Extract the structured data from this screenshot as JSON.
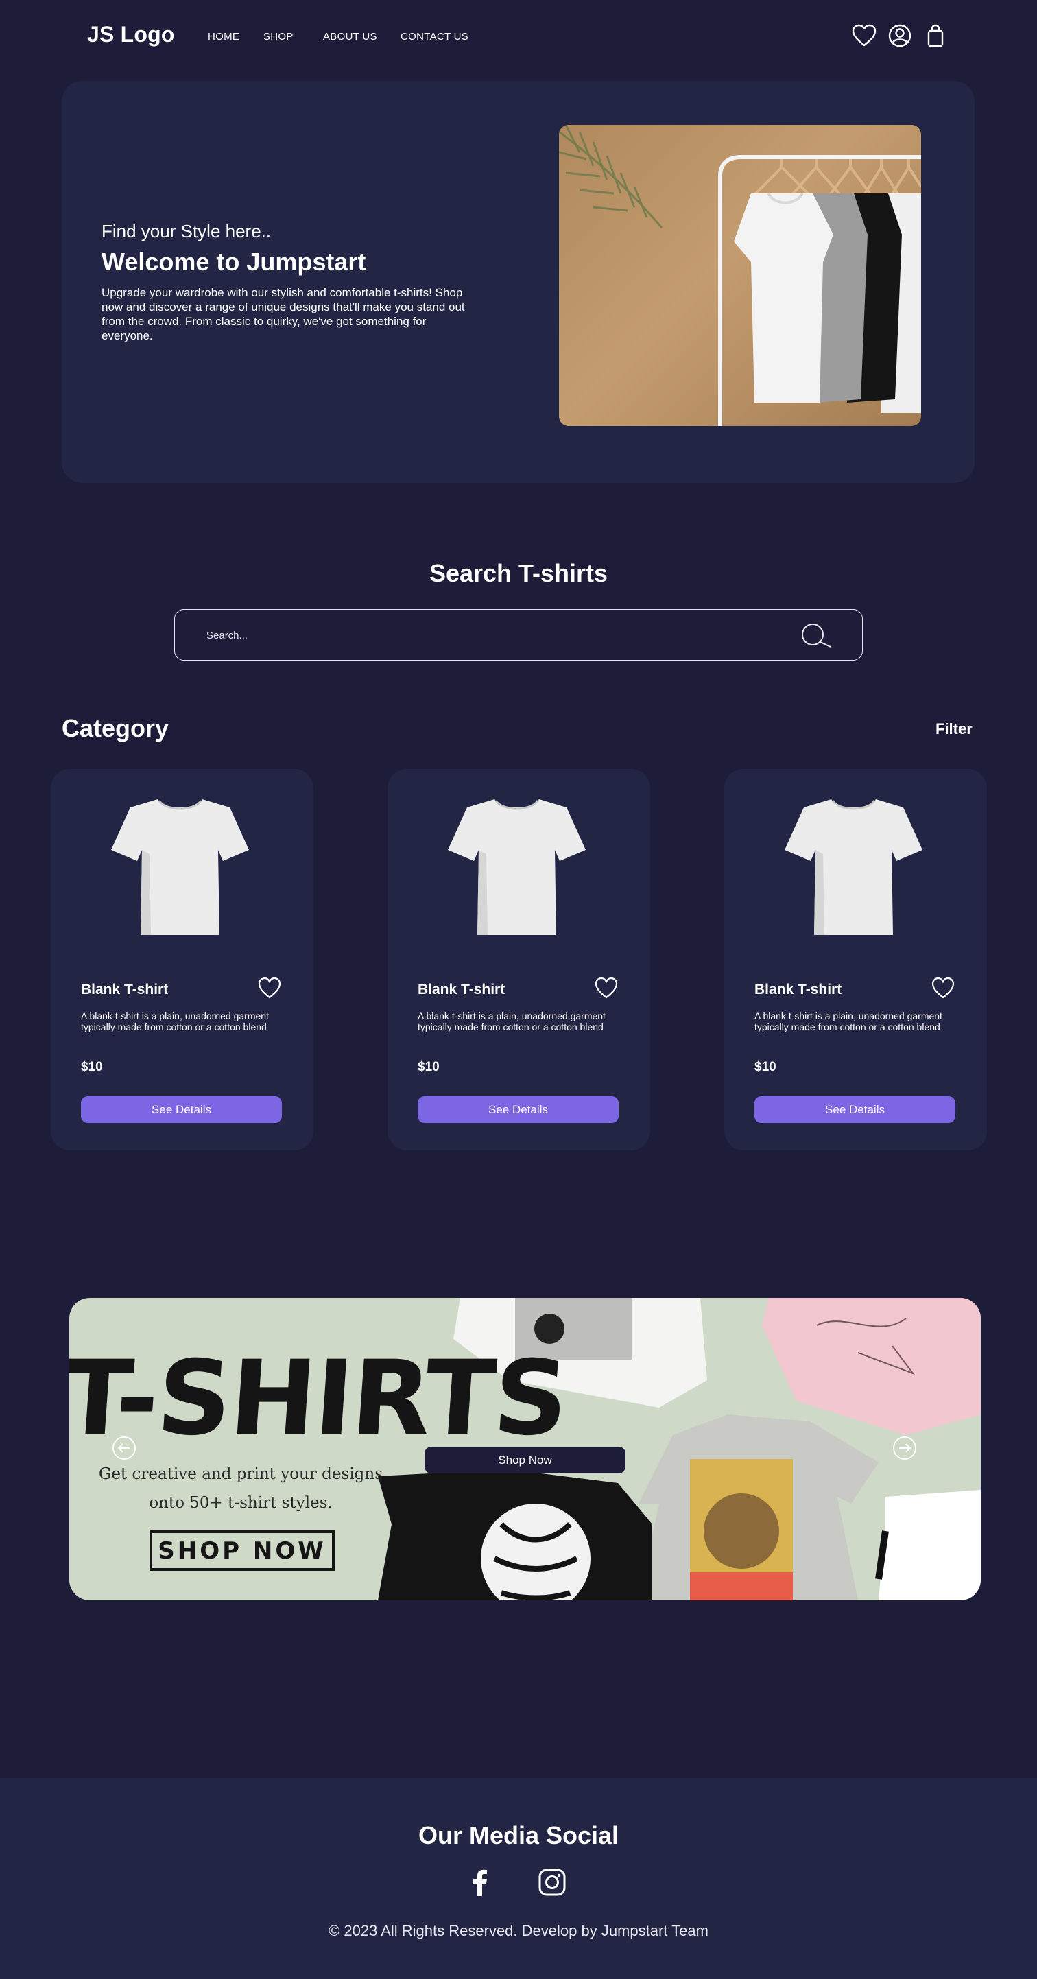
{
  "header": {
    "logo": "JS Logo",
    "nav": [
      "HOME",
      "SHOP",
      "ABOUT US",
      "CONTACT US"
    ],
    "icons": [
      "heart-icon",
      "user-icon",
      "bag-icon"
    ]
  },
  "hero": {
    "subtitle": "Find your Style here..",
    "title": "Welcome to Jumpstart",
    "description": "Upgrade your wardrobe with our stylish and comfortable t-shirts! Shop now and discover a range of unique designs that'll make you stand out from the crowd. From classic to quirky, we've got something for everyone."
  },
  "search": {
    "title": "Search T-shirts",
    "placeholder": "Search..."
  },
  "category": {
    "title": "Category",
    "filter_label": "Filter",
    "products": [
      {
        "name": "Blank T-shirt",
        "description": "A blank t-shirt is a plain, unadorned garment typically made from cotton or a cotton blend",
        "price": "$10",
        "button": "See Details"
      },
      {
        "name": "Blank T-shirt",
        "description": "A blank t-shirt is a plain, unadorned garment typically made from cotton or a cotton blend",
        "price": "$10",
        "button": "See Details"
      },
      {
        "name": "Blank T-shirt",
        "description": "A blank t-shirt is a plain, unadorned garment typically made from cotton or a cotton blend",
        "price": "$10",
        "button": "See Details"
      }
    ]
  },
  "banner": {
    "image_word": "T-SHIRTS",
    "image_copy": "Get creative and print your designs onto 50+ t-shirt styles.",
    "image_box": "SHOP NOW",
    "button": "Shop Now"
  },
  "footer": {
    "title": "Our Media Social",
    "social": [
      "facebook-icon",
      "instagram-icon"
    ],
    "copyright": "© 2023 All Rights Reserved. Develop by Jumpstart Team"
  },
  "colors": {
    "background": "#1d1d3a",
    "card": "#222544",
    "accent": "#7c66e4",
    "text": "#ffffff"
  }
}
